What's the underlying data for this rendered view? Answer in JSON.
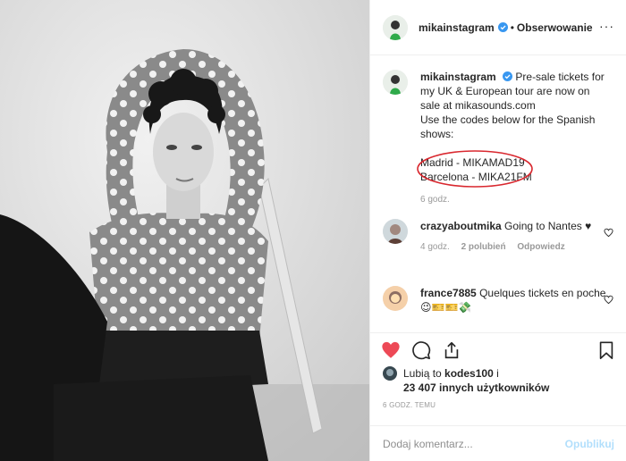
{
  "post": {
    "author": {
      "username": "mikainstagram",
      "verified_icon": "verified-badge-icon"
    },
    "header": {
      "separator": "•",
      "follow_label": "Obserwowanie",
      "more_label": "···"
    },
    "caption": {
      "username": "mikainstagram",
      "lines": [
        "Pre-sale tickets for",
        "my UK & European tour are now on",
        "sale at mikasounds.com",
        "Use the codes below for the Spanish",
        "shows:"
      ],
      "codes": [
        "Madrid - MIKAMAD19",
        "Barcelona - MIKA21FM"
      ],
      "time": "6 godz."
    },
    "comments": [
      {
        "username": "crazyaboutmika",
        "text": "Going to Nantes ♥",
        "time": "4 godz.",
        "likes": "2 polubień",
        "reply_label": "Odpowiedz"
      },
      {
        "username": "france7885",
        "text": "Quelques tickets en poche 😉🎫🎫💸"
      }
    ],
    "likes": {
      "prefix": "Lubią to",
      "first_liker": "kodes100",
      "connector": "i",
      "others": "23 407 innych użytkowników"
    },
    "timestamp": "6 GODZ. TEMU",
    "add_comment": {
      "placeholder": "Dodaj komentarz...",
      "publish_label": "Opublikuj"
    },
    "colors": {
      "text": "#262626",
      "muted": "#999999",
      "liked_heart": "#ed4956",
      "verified": "#3897f0",
      "publish_disabled": "#b2dffc",
      "annotation": "#d9282f"
    }
  }
}
